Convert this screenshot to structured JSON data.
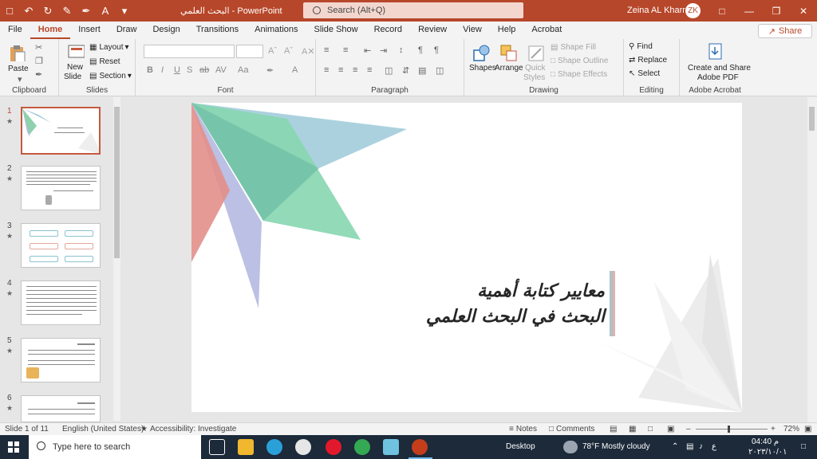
{
  "titlebar": {
    "title": "البحث العلمي  -  PowerPoint",
    "search_placeholder": "Search (Alt+Q)",
    "user_name": "Zeina AL Kharrat",
    "avatar_initials": "ZK",
    "accent": "#b7472a"
  },
  "menu": {
    "items": [
      "File",
      "Home",
      "Insert",
      "Draw",
      "Design",
      "Transitions",
      "Animations",
      "Slide Show",
      "Record",
      "Review",
      "View",
      "Help",
      "Acrobat"
    ],
    "active": "Home",
    "share_label": "Share"
  },
  "ribbon": {
    "clipboard": {
      "label": "Clipboard",
      "paste": "Paste"
    },
    "slides": {
      "label": "Slides",
      "new_slide": "New",
      "new_slide2": "Slide",
      "layout": "Layout",
      "reset": "Reset",
      "section": "Section"
    },
    "font": {
      "label": "Font"
    },
    "paragraph": {
      "label": "Paragraph"
    },
    "drawing": {
      "label": "Drawing",
      "shapes": "Shapes",
      "arrange": "Arrange",
      "quick_styles": "Quick",
      "quick_styles2": "Styles",
      "shape_fill": "Shape Fill",
      "shape_outline": "Shape Outline",
      "shape_effects": "Shape Effects"
    },
    "editing": {
      "label": "Editing",
      "find": "Find",
      "replace": "Replace",
      "select": "Select"
    },
    "acrobat": {
      "label": "Adobe Acrobat",
      "create_share": "Create and Share",
      "adobe_pdf": "Adobe PDF"
    }
  },
  "slides_pane": {
    "numbers": [
      "1",
      "2",
      "3",
      "4",
      "5",
      "6"
    ]
  },
  "slide": {
    "title_line1": "معايير كتابة أهمية",
    "title_line2": "البحث في البحث العلمي"
  },
  "status": {
    "slide_info": "Slide 1 of 11",
    "language": "English (United States)",
    "accessibility": "Accessibility: Investigate",
    "notes": "Notes",
    "comments": "Comments",
    "zoom": "72%"
  },
  "taskbar": {
    "search_placeholder": "Type here to search",
    "desktop": "Desktop",
    "weather": "78°F  Mostly cloudy",
    "lang": "ع",
    "time": "04:40 م",
    "date": "٢٠٢٣/١٠/٠١"
  }
}
